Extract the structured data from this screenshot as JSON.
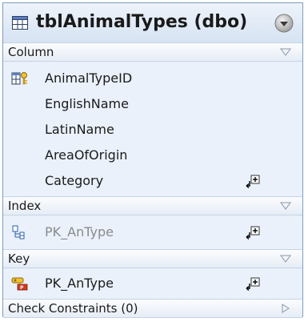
{
  "table": {
    "title": "tblAnimalTypes (dbo)",
    "icon": "table-grid-icon",
    "menu_icon": "dropdown-menu-icon"
  },
  "sections": {
    "column": {
      "title": "Column",
      "rows": [
        {
          "label": "AnimalTypeID",
          "icon": "primary-key-column-icon"
        },
        {
          "label": "EnglishName"
        },
        {
          "label": "LatinName"
        },
        {
          "label": "AreaOfOrigin"
        },
        {
          "label": "Category",
          "action_icon": "add-item-icon"
        }
      ]
    },
    "index": {
      "title": "Index",
      "rows": [
        {
          "label": "PK_AnType",
          "icon": "index-icon",
          "action_icon": "add-item-icon"
        }
      ]
    },
    "key": {
      "title": "Key",
      "rows": [
        {
          "label": "PK_AnType",
          "icon": "primary-key-icon",
          "action_icon": "add-item-icon"
        }
      ]
    },
    "check_constraints": {
      "title": "Check Constraints (0)"
    }
  },
  "colors": {
    "title_gradient_top": "#eef3fa",
    "title_gradient_bottom": "#d6e3f3",
    "body_background": "#eaf1fb",
    "border": "#7f9db9",
    "muted_text": "#8a8a8a"
  }
}
